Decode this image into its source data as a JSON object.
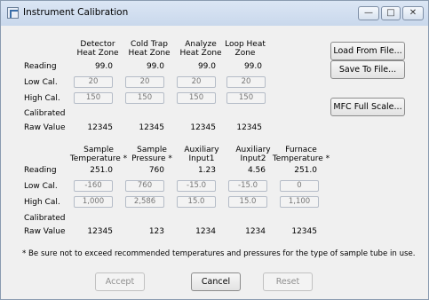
{
  "window": {
    "title": "Instrument Calibration",
    "minimize_glyph": "—",
    "maximize_glyph": "□",
    "close_glyph": "✕"
  },
  "row_labels": {
    "reading": "Reading",
    "low": "Low Cal.",
    "high": "High Cal.",
    "calibrated": "Calibrated",
    "raw": "Raw Value"
  },
  "section1": {
    "columns": [
      {
        "header": [
          "Detector",
          "Heat Zone"
        ],
        "reading": "99.0",
        "low": "20",
        "high": "150",
        "raw": "12345"
      },
      {
        "header": [
          "Cold Trap",
          "Heat Zone"
        ],
        "reading": "99.0",
        "low": "20",
        "high": "150",
        "raw": "12345"
      },
      {
        "header": [
          "Analyze",
          "Heat Zone"
        ],
        "reading": "99.0",
        "low": "20",
        "high": "150",
        "raw": "12345"
      },
      {
        "header": [
          "Loop Heat",
          "Zone"
        ],
        "reading": "99.0",
        "low": "20",
        "high": "150",
        "raw": "12345"
      }
    ]
  },
  "section2": {
    "columns": [
      {
        "header": [
          "Sample",
          "Temperature *"
        ],
        "reading": "251.0",
        "low": "-160",
        "high": "1,000",
        "raw": "12345"
      },
      {
        "header": [
          "Sample",
          "Pressure *"
        ],
        "reading": "760",
        "low": "760",
        "high": "2,586",
        "raw": "123"
      },
      {
        "header": [
          "Auxiliary",
          "Input1"
        ],
        "reading": "1.23",
        "low": "-15.0",
        "high": "15.0",
        "raw": "1234"
      },
      {
        "header": [
          "Auxiliary",
          "Input2"
        ],
        "reading": "4.56",
        "low": "-15.0",
        "high": "15.0",
        "raw": "1234"
      },
      {
        "header": [
          "Furnace",
          "Temperature *"
        ],
        "reading": "251.0",
        "low": "0",
        "high": "1,100",
        "raw": "12345"
      }
    ]
  },
  "side_buttons": {
    "load": "Load From File...",
    "save": "Save To File...",
    "mfc": "MFC Full Scale..."
  },
  "note": "* Be sure not to exceed recommended temperatures and pressures for the type of sample tube in use.",
  "bottom_buttons": {
    "accept": "Accept",
    "cancel": "Cancel",
    "reset": "Reset"
  }
}
